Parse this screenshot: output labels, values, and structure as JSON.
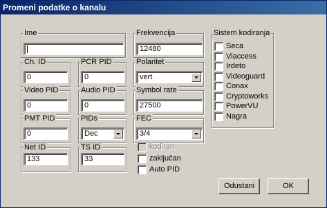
{
  "window": {
    "title": "Promeni podatke o kanalu"
  },
  "fields": {
    "ime": {
      "label": "Ime",
      "value": ""
    },
    "frekvencija": {
      "label": "Frekvencija",
      "value": "12480"
    },
    "ch_id": {
      "label": "Ch. ID",
      "value": "0"
    },
    "pcr_pid": {
      "label": "PCR PID",
      "value": "0"
    },
    "polaritet": {
      "label": "Polaritet",
      "value": "vert"
    },
    "video_pid": {
      "label": "Video PID",
      "value": "0"
    },
    "audio_pid": {
      "label": "Audio PID",
      "value": "0"
    },
    "symbol_rate": {
      "label": "Symbol rate",
      "value": "27500"
    },
    "pmt_pid": {
      "label": "PMT PID",
      "value": "0"
    },
    "pids": {
      "label": "PIDs",
      "value": "Dec"
    },
    "fec": {
      "label": "FEC",
      "value": "3/4"
    },
    "net_id": {
      "label": "Net ID",
      "value": "133"
    },
    "ts_id": {
      "label": "TS ID",
      "value": "33"
    }
  },
  "options": {
    "kodiran": {
      "label": "kodiran",
      "checked": false,
      "enabled": false
    },
    "zakljucan": {
      "label": "zaključan",
      "checked": false
    },
    "auto_pid": {
      "label": "Auto PID",
      "checked": false
    }
  },
  "sistem": {
    "label": "Sistem kodiranja",
    "items": [
      "Seca",
      "Viaccess",
      "Irdeto",
      "Videoguard",
      "Conax",
      "Cryptoworks",
      "PowerVU",
      "Nagra"
    ]
  },
  "buttons": {
    "cancel": "Odustani",
    "ok": "OK"
  }
}
